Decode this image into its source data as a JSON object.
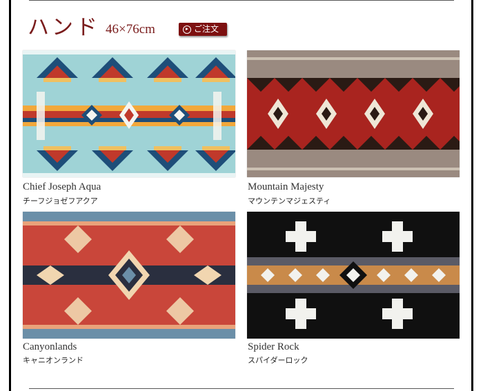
{
  "header": {
    "title": "ハンド",
    "size": "46×76cm",
    "order_label": "ご注文"
  },
  "colors": {
    "accent": "#7a1c1c",
    "button": "#7d1010"
  },
  "products": [
    {
      "name_en": "Chief Joseph Aqua",
      "name_jp": "チーフジョゼフアクア",
      "image": "chief-joseph-aqua-towel"
    },
    {
      "name_en": "Mountain Majesty",
      "name_jp": "マウンテンマジェスティ",
      "image": "mountain-majesty-towel"
    },
    {
      "name_en": "Canyonlands",
      "name_jp": "キャニオンランド",
      "image": "canyonlands-towel"
    },
    {
      "name_en": "Spider Rock",
      "name_jp": "スパイダーロック",
      "image": "spider-rock-towel"
    }
  ]
}
